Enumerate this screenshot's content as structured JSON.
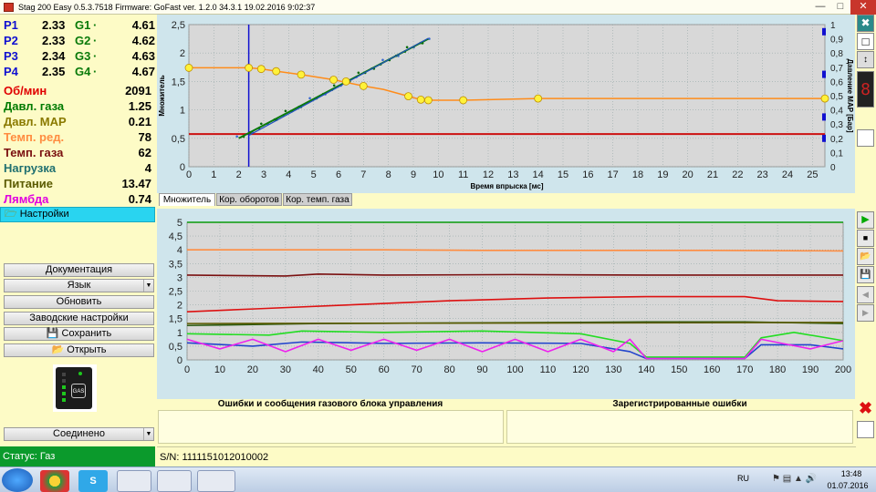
{
  "titlebar": {
    "title": "Stag 200 Easy 0.5.3.7518 Firmware: GoFast  ver. 1.2.0  34.3.1   19.02.2016 9:02:37"
  },
  "pressures": [
    {
      "p_label": "P1",
      "p_value": "2.33",
      "g_label": "G1",
      "g_value": "4.61"
    },
    {
      "p_label": "P2",
      "p_value": "2.33",
      "g_label": "G2",
      "g_value": "4.62"
    },
    {
      "p_label": "P3",
      "p_value": "2.34",
      "g_label": "G3",
      "g_value": "4.63"
    },
    {
      "p_label": "P4",
      "p_value": "2.35",
      "g_label": "G4",
      "g_value": "4.67"
    }
  ],
  "sensors": [
    {
      "label": "Об/мин",
      "value": "2091",
      "color": "#e00000"
    },
    {
      "label": "Давл. газа",
      "value": "1.25",
      "color": "#007a00"
    },
    {
      "label": "Давл. MAP",
      "value": "0.21",
      "color": "#8a7a00"
    },
    {
      "label": "Темп. ред.",
      "value": "78",
      "color": "#ff8c40"
    },
    {
      "label": "Темп. газа",
      "value": "62",
      "color": "#7a1010"
    },
    {
      "label": "Нагрузка",
      "value": "4",
      "color": "#207070"
    },
    {
      "label": "Питание",
      "value": "13.47",
      "color": "#5a5a00"
    },
    {
      "label": "Лямбда",
      "value": "0.74",
      "color": "#e000e0"
    }
  ],
  "left_panel": {
    "settings_label": "Настройки",
    "btn_docs": "Документация",
    "btn_language": "Язык",
    "btn_update": "Обновить",
    "btn_factory": "Заводские настройки",
    "btn_save": "Сохранить",
    "btn_open": "Открыть",
    "connection_select": "Соединено",
    "gas_label": "GAS"
  },
  "tabs": [
    {
      "label": "Множитель",
      "active": true
    },
    {
      "label": "Кор. оборотов",
      "active": false
    },
    {
      "label": "Кор. темп. газа",
      "active": false
    }
  ],
  "errors": {
    "left_header": "Ошибки и сообщения газового блока управления",
    "right_header": "Зарегистрированные ошибки"
  },
  "status": {
    "text": "Статус: Газ",
    "serial": "S/N: 1111151012010002"
  },
  "taskbar": {
    "lang": "RU",
    "time": "13:48",
    "date": "01.07.2016"
  },
  "chart_data": [
    {
      "type": "line",
      "xlabel": "Время впрыска [мс]",
      "ylabel": "Множитель",
      "y2label": "Давление MAP [Бар]",
      "xlim": [
        0,
        25.5
      ],
      "ylim": [
        0,
        2.5
      ],
      "y2lim": [
        0,
        1
      ],
      "x_ticks": [
        "0",
        "1",
        "2",
        "3",
        "4",
        "5",
        "6",
        "7",
        "8",
        "9",
        "10",
        "11",
        "12",
        "13",
        "14",
        "15",
        "16",
        "17",
        "18",
        "19",
        "20",
        "21",
        "22",
        "23",
        "24",
        "25"
      ],
      "y_ticks": [
        "0",
        "0,5",
        "1",
        "1,5",
        "2",
        "2,5"
      ],
      "y2_ticks": [
        "0",
        "0,1",
        "0,2",
        "0,3",
        "0,4",
        "0,5",
        "0,6",
        "0,7",
        "0,8",
        "0,9",
        "1"
      ],
      "grid": true,
      "multiplier_curve": {
        "color": "#ff8c1a",
        "points": [
          [
            0,
            1.74
          ],
          [
            2.4,
            1.74
          ],
          [
            2.9,
            1.72
          ],
          [
            3.5,
            1.68
          ],
          [
            4.5,
            1.62
          ],
          [
            5.8,
            1.53
          ],
          [
            7,
            1.42
          ],
          [
            7.8,
            1.36
          ],
          [
            8.8,
            1.24
          ],
          [
            9.3,
            1.18
          ],
          [
            9.6,
            1.17
          ],
          [
            11,
            1.17
          ],
          [
            14,
            1.2
          ],
          [
            25.5,
            1.2
          ]
        ],
        "nodes": [
          [
            0,
            1.74
          ],
          [
            2.4,
            1.74
          ],
          [
            2.9,
            1.72
          ],
          [
            3.5,
            1.68
          ],
          [
            4.5,
            1.62
          ],
          [
            5.8,
            1.53
          ],
          [
            6.3,
            1.5
          ],
          [
            7,
            1.42
          ],
          [
            8.8,
            1.24
          ],
          [
            9.3,
            1.18
          ],
          [
            9.6,
            1.17
          ],
          [
            11,
            1.17
          ],
          [
            14,
            1.2
          ],
          [
            25.5,
            1.2
          ]
        ]
      },
      "gas_line": {
        "color": "#0a7a0a",
        "from": [
          2,
          0.5
        ],
        "to": [
          9.6,
          2.25
        ]
      },
      "petrol_line": {
        "color": "#2050c0",
        "from": [
          2.4,
          0.55
        ],
        "to": [
          9.6,
          2.26
        ]
      },
      "map_level": {
        "color": "#cc1111",
        "value": 0.23
      },
      "cursor_x": 2.4,
      "cursor_color": "#1010d0"
    },
    {
      "type": "line",
      "xlim": [
        0,
        200
      ],
      "ylim": [
        0,
        5
      ],
      "x_ticks": [
        "0",
        "10",
        "20",
        "30",
        "40",
        "50",
        "60",
        "70",
        "80",
        "90",
        "100",
        "110",
        "120",
        "130",
        "140",
        "150",
        "160",
        "170",
        "180",
        "190",
        "200"
      ],
      "y_ticks": [
        "0",
        "0,5",
        "1",
        "1,5",
        "2",
        "2,5",
        "3",
        "3,5",
        "4",
        "4,5",
        "5"
      ],
      "grid": true,
      "series": [
        {
          "color": "#0a9a0a",
          "values": [
            [
              0,
              5
            ],
            [
              200,
              5
            ]
          ]
        },
        {
          "color": "#ff8c40",
          "values": [
            [
              0,
              4
            ],
            [
              60,
              4
            ],
            [
              90,
              3.98
            ],
            [
              160,
              3.98
            ],
            [
              200,
              3.96
            ]
          ]
        },
        {
          "color": "#7a1010",
          "values": [
            [
              0,
              3.08
            ],
            [
              30,
              3.05
            ],
            [
              40,
              3.12
            ],
            [
              60,
              3.08
            ],
            [
              100,
              3.1
            ],
            [
              140,
              3.08
            ],
            [
              200,
              3.08
            ]
          ]
        },
        {
          "color": "#dd1111",
          "values": [
            [
              0,
              1.75
            ],
            [
              20,
              1.85
            ],
            [
              50,
              2.0
            ],
            [
              80,
              2.15
            ],
            [
              110,
              2.25
            ],
            [
              140,
              2.3
            ],
            [
              170,
              2.3
            ],
            [
              180,
              2.15
            ],
            [
              200,
              2.12
            ]
          ]
        },
        {
          "color": "#2a5a10",
          "values": [
            [
              0,
              1.25
            ],
            [
              40,
              1.32
            ],
            [
              60,
              1.33
            ],
            [
              100,
              1.35
            ],
            [
              140,
              1.38
            ],
            [
              170,
              1.38
            ],
            [
              200,
              1.32
            ]
          ]
        },
        {
          "color": "#5a5a00",
          "values": [
            [
              0,
              1.32
            ],
            [
              100,
              1.34
            ],
            [
              200,
              1.36
            ]
          ]
        },
        {
          "color": "#22dd22",
          "values": [
            [
              0,
              0.95
            ],
            [
              25,
              0.9
            ],
            [
              35,
              1.05
            ],
            [
              60,
              1.0
            ],
            [
              90,
              1.05
            ],
            [
              120,
              0.95
            ],
            [
              135,
              0.6
            ],
            [
              140,
              0.1
            ],
            [
              170,
              0.1
            ],
            [
              175,
              0.8
            ],
            [
              185,
              1.0
            ],
            [
              200,
              0.7
            ]
          ]
        },
        {
          "color": "#2244cc",
          "values": [
            [
              0,
              0.62
            ],
            [
              20,
              0.5
            ],
            [
              35,
              0.65
            ],
            [
              60,
              0.6
            ],
            [
              90,
              0.62
            ],
            [
              120,
              0.6
            ],
            [
              135,
              0.3
            ],
            [
              140,
              0.05
            ],
            [
              170,
              0.05
            ],
            [
              175,
              0.55
            ],
            [
              190,
              0.55
            ],
            [
              200,
              0.4
            ]
          ]
        },
        {
          "color": "#ee22ee",
          "values": [
            [
              0,
              0.75
            ],
            [
              10,
              0.4
            ],
            [
              20,
              0.75
            ],
            [
              30,
              0.3
            ],
            [
              40,
              0.75
            ],
            [
              50,
              0.35
            ],
            [
              60,
              0.75
            ],
            [
              70,
              0.35
            ],
            [
              80,
              0.75
            ],
            [
              90,
              0.3
            ],
            [
              100,
              0.75
            ],
            [
              110,
              0.3
            ],
            [
              120,
              0.75
            ],
            [
              130,
              0.3
            ],
            [
              135,
              0.75
            ],
            [
              140,
              0.05
            ],
            [
              170,
              0.05
            ],
            [
              175,
              0.75
            ],
            [
              190,
              0.4
            ],
            [
              200,
              0.7
            ]
          ]
        }
      ]
    }
  ]
}
